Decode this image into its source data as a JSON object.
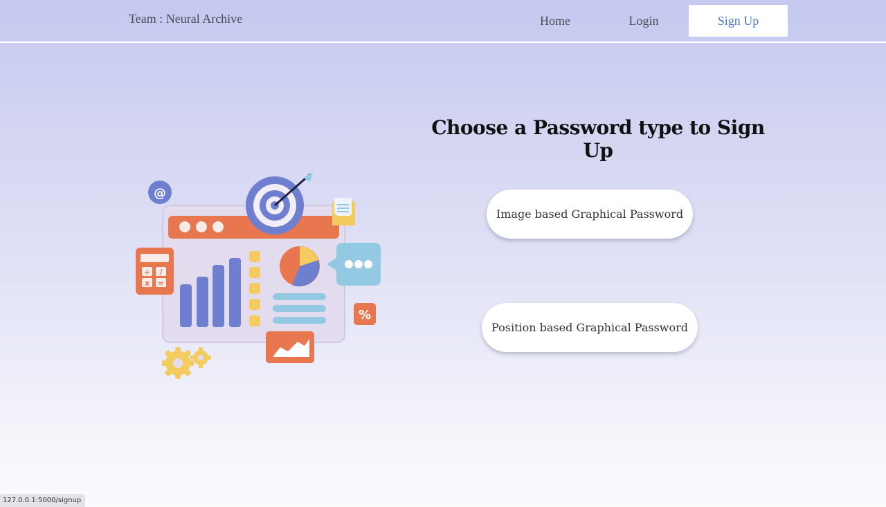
{
  "navbar": {
    "brand": "Team : Neural Archive",
    "links": {
      "home": "Home",
      "login": "Login",
      "signup": "Sign Up"
    },
    "active": "Sign Up"
  },
  "main": {
    "heading": "Choose a Password type to Sign Up",
    "options": {
      "image_based": "Image based Graphical Password",
      "position_based": "Position based Graphical Password"
    }
  },
  "illustration": {
    "icon": "analytics-dashboard-illustration",
    "calculator_symbols": [
      "+",
      "/",
      "x",
      "="
    ],
    "at_symbol": "@",
    "percent_symbol": "%"
  },
  "status_bar": {
    "url": "127.0.0.1:5000/signup"
  },
  "colors": {
    "accent": "#4a78c8",
    "navbar_bg": "#c5c8ef",
    "button_bg": "#ffffff",
    "illustration_orange": "#e8764f",
    "illustration_blue": "#6f7fcf",
    "illustration_yellow": "#f3cb5f",
    "illustration_lightblue": "#93c9e3"
  }
}
